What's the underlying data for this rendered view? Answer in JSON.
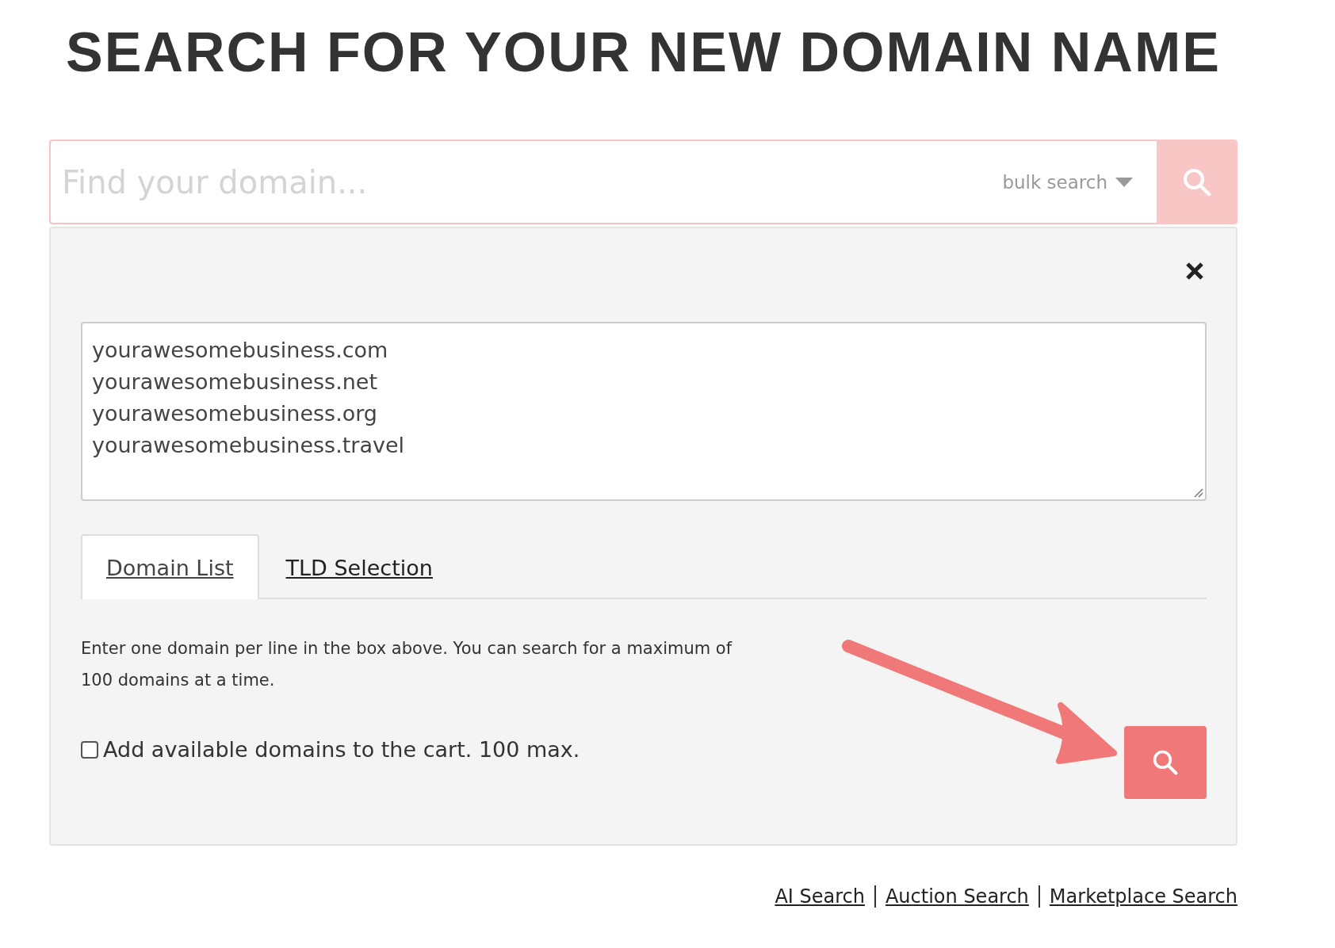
{
  "title": "SEARCH FOR YOUR NEW DOMAIN NAME",
  "search": {
    "placeholder": "Find your domain...",
    "mode_label": "bulk search"
  },
  "bulk_panel": {
    "domains": [
      "yourawesomebusiness.com",
      "yourawesomebusiness.net",
      "yourawesomebusiness.org",
      "yourawesomebusiness.travel"
    ],
    "tabs": [
      {
        "label": "Domain List",
        "selected": true
      },
      {
        "label": "TLD Selection",
        "selected": false
      }
    ],
    "help": "Enter one domain per line in the box above. You can search for a maximum of 100 domains at a time.",
    "add_to_cart": {
      "label": "Add available domains to the cart. 100 max.",
      "checked": false
    }
  },
  "footer_links": [
    "AI Search",
    "Auction Search",
    "Marketplace Search"
  ]
}
